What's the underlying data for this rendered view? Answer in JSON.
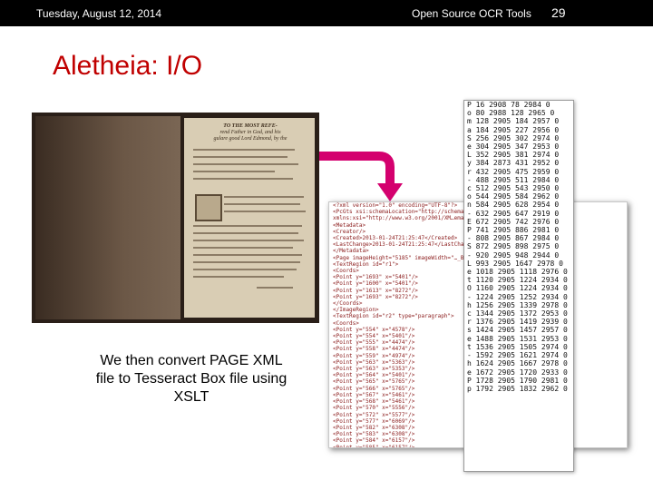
{
  "header": {
    "date": "Tuesday, August 12, 2014",
    "title": "Open Source OCR Tools",
    "slide_number": "29"
  },
  "slide": {
    "title": "Aletheia: I/O",
    "caption_lines": [
      "We then convert PAGE XML",
      "file to Tesseract Box file using",
      "XSLT"
    ]
  },
  "book_image": {
    "heading_lines": [
      "TO THE MOST REFE-",
      "rend Father in God, and his",
      "gulare good Lord Edmond, by the"
    ]
  },
  "xml_lines": [
    "<?xml version=\"1.0\" encoding=\"UTF-8\"?>",
    "<PcGts xsi:schemaLocation=\"http://schema.p…ntent/2010",
    "xmlns:xsi=\"http://www.w3.org/2001/XM…ema.primar",
    "  <Metadata>",
    "    <Creator/>",
    "    <Created>2013-01-24T21:25:47</Created>",
    "    <LastChange>2013-01-24T21:25:47</LastChange>",
    "  </Metadata>",
    "  <Page imageHeight=\"5185\" imageWidth=\"…_B.tif\">",
    "    <TextRegion id=\"r1\">",
    "      <Coords>",
    "        <Point y=\"1693\" x=\"5401\"/>",
    "        <Point y=\"1600\" x=\"5401\"/>",
    "        <Point y=\"1613\" x=\"8272\"/>",
    "        <Point y=\"1693\" x=\"8272\"/>",
    "      </Coords>",
    "    </ImageRegion>",
    "    <TextRegion id=\"r2\" type=\"paragraph\">",
    "      <Coords>",
    "        <Point y=\"554\" x=\"4578\"/>",
    "        <Point y=\"554\" x=\"5401\"/>",
    "        <Point y=\"555\" x=\"4474\"/>",
    "        <Point y=\"558\" x=\"4474\"/>",
    "        <Point y=\"559\" x=\"4974\"/>",
    "        <Point y=\"563\" x=\"5363\"/>",
    "        <Point y=\"563\" x=\"5353\"/>",
    "        <Point y=\"564\" x=\"5401\"/>",
    "        <Point y=\"565\" x=\"5765\"/>",
    "        <Point y=\"566\" x=\"5765\"/>",
    "        <Point y=\"567\" x=\"5461\"/>",
    "        <Point y=\"568\" x=\"5461\"/>",
    "        <Point y=\"570\" x=\"5556\"/>",
    "        <Point y=\"572\" x=\"5577\"/>",
    "        <Point y=\"577\" x=\"6069\"/>",
    "        <Point y=\"582\" x=\"6308\"/>",
    "        <Point y=\"583\" x=\"6308\"/>",
    "        <Point y=\"584\" x=\"6157\"/>",
    "        <Point y=\"585\" x=\"6157\"/>"
  ],
  "box_lines": [
    "P 16  2908 78  2984 0",
    "o 80  2988 128 2965 0",
    "m 128 2905 184 2957 0",
    "a 184 2905 227 2956 0",
    "S 256 2905 302 2974 0",
    "e 304 2905 347 2953 0",
    "L 352 2905 381 2974 0",
    "y 384 2873 431 2952 0",
    "r 432 2905 475 2959 0",
    "- 488 2905 511 2984 0",
    "c 512 2905 543 2950 0",
    "o 544 2905 584 2962 0",
    "n 584 2905 628 2954 0",
    "- 632 2905 647 2919 0",
    "E 672 2905 742 2976 0",
    "P 741 2905 886 2981 0",
    "- 808 2905 867 2984 0",
    "S 872 2905 898 2975 0",
    "- 920 2905 948 2944 0",
    "L 993 2905 1647 2978 0",
    "e 1018 2905 1118 2976 0",
    "t 1120 2905 1224 2934 0",
    "O 1160 2905 1224 2934 0",
    "- 1224 2905 1252 2934 0",
    "h 1256 2905 1339 2978 0",
    "c 1344 2905 1372 2953 0",
    "r 1376 2905 1419 2939 0",
    "s 1424 2905 1457 2957 0",
    "e 1488 2905 1531 2953 0",
    "t 1536 2905 1505 2974 0",
    "- 1592 2905 1621 2974 0",
    "h 1624 2905 1667 2978 0",
    "e 1672 2905 1720 2933 0",
    "P 1728 2905 1790 2981 0",
    "p 1792 2905 1832 2962 0"
  ]
}
